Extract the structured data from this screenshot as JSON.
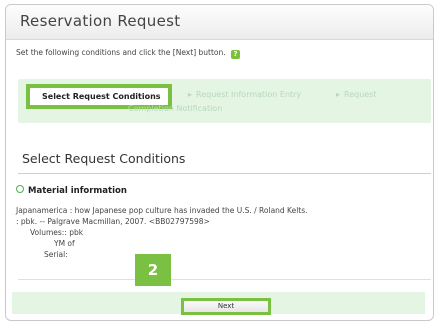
{
  "header": {
    "title": "Reservation Request"
  },
  "instruction": {
    "text": "Set the following conditions and click the [Next] button.",
    "help_icon": "?"
  },
  "steps": {
    "current": "Select Request Conditions",
    "step2": "Request Information Entry",
    "step3": "Request",
    "step4": "Completion Notification",
    "separator": "▸"
  },
  "section": {
    "title": "Select Request Conditions"
  },
  "material": {
    "heading": "Material information",
    "line1": "Japanamerica : how Japanese pop culture has invaded the U.S. / Roland Kelts.",
    "line2": ": pbk. -- Palgrave Macmillan, 2007.  <BB02797598>",
    "volumes": "Volumes:: pbk",
    "ym_of": "YM of",
    "serial": "Serial:"
  },
  "badge": {
    "number": "2"
  },
  "footer": {
    "next_label": "Next"
  },
  "colors": {
    "accent": "#7ac143",
    "step_bg": "#e4f5e4"
  }
}
